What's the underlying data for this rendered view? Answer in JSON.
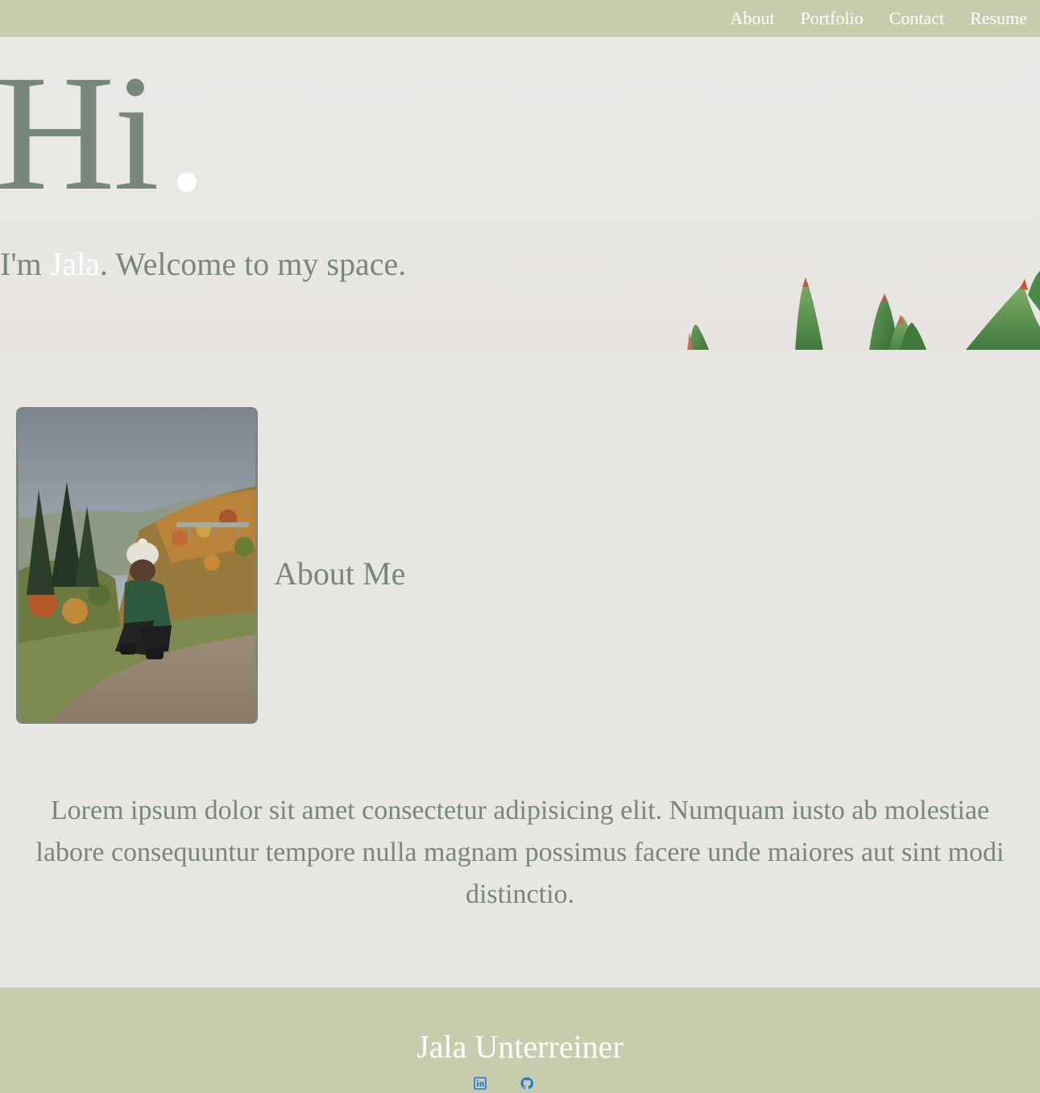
{
  "nav": {
    "items": [
      {
        "label": "About"
      },
      {
        "label": "Portfolio"
      },
      {
        "label": "Contact"
      },
      {
        "label": "Resume"
      }
    ]
  },
  "hero": {
    "greeting": "Hi",
    "intro_prefix": "I'm ",
    "name": "Jala",
    "intro_suffix": ". Welcome to my space."
  },
  "about": {
    "heading": "About Me",
    "body": "Lorem ipsum dolor sit amet consectetur adipisicing elit. Numquam iusto ab molestiae labore consequuntur tempore nulla magnam possimus facere unde maiores aut sint modi distinctio."
  },
  "footer": {
    "name": "Jala Unterreiner",
    "links": [
      {
        "icon": "linkedin-icon"
      },
      {
        "icon": "github-icon"
      }
    ]
  },
  "colors": {
    "accent_bar": "#c7cdac",
    "text_sage": "#77877a",
    "background": "#e8e6e3",
    "link_blue": "#1a73e8"
  }
}
